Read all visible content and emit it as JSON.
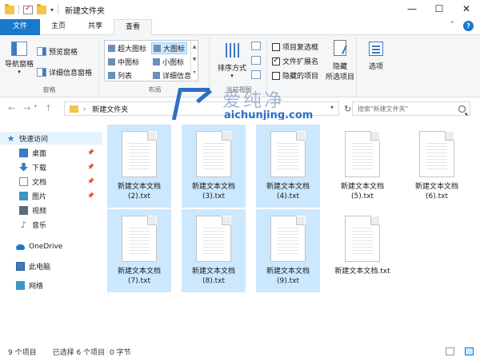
{
  "window": {
    "title": "新建文件夹",
    "minimize": "—",
    "maximize": "☐",
    "close": "✕"
  },
  "tabs": [
    {
      "label": "文件"
    },
    {
      "label": "主页"
    },
    {
      "label": "共享"
    },
    {
      "label": "查看"
    }
  ],
  "ribbon": {
    "panes": {
      "nav_pane": "导航窗格",
      "preview_pane": "预览窗格",
      "details_pane": "详细信息窗格",
      "label": "窗格"
    },
    "layout": {
      "options": [
        "超大图标",
        "大图标",
        "中图标",
        "小图标",
        "列表",
        "详细信息"
      ],
      "selected": "大图标",
      "label": "布局"
    },
    "current_view": {
      "sort": "排序方式",
      "label": "当前视图"
    },
    "show_hide": {
      "item_checkboxes": "项目复选框",
      "file_extensions": "文件扩展名",
      "hidden_items": "隐藏的项目",
      "hide_selected_1": "隐藏",
      "hide_selected_2": "所选项目"
    },
    "options": "选项"
  },
  "address": {
    "path": "新建文件夹",
    "search_placeholder": "搜索\"新建文件夹\""
  },
  "watermark": {
    "cn": "爱纯净",
    "en": "aichunjing.com"
  },
  "sidebar": {
    "items": [
      {
        "label": "快速访问"
      },
      {
        "label": "桌面"
      },
      {
        "label": "下载"
      },
      {
        "label": "文档"
      },
      {
        "label": "图片"
      },
      {
        "label": "视频"
      },
      {
        "label": "音乐"
      },
      {
        "label": "OneDrive"
      },
      {
        "label": "此电脑"
      },
      {
        "label": "网络"
      }
    ]
  },
  "files": [
    {
      "l1": "新建文本文档",
      "l2": "(2).txt",
      "selected": true
    },
    {
      "l1": "新建文本文档",
      "l2": "(3).txt",
      "selected": true
    },
    {
      "l1": "新建文本文档",
      "l2": "(4).txt",
      "selected": true
    },
    {
      "l1": "新建文本文档",
      "l2": "(5).txt",
      "selected": false
    },
    {
      "l1": "新建文本文档",
      "l2": "(6).txt",
      "selected": false
    },
    {
      "l1": "新建文本文档",
      "l2": "(7).txt",
      "selected": true
    },
    {
      "l1": "新建文本文档",
      "l2": "(8).txt",
      "selected": true
    },
    {
      "l1": "新建文本文档",
      "l2": "(9).txt",
      "selected": true
    },
    {
      "l1": "新建文本文档.txt",
      "l2": "",
      "selected": false
    }
  ],
  "status": {
    "count": "9 个项目",
    "selected": "已选择 6 个项目",
    "size": "0 字节"
  }
}
